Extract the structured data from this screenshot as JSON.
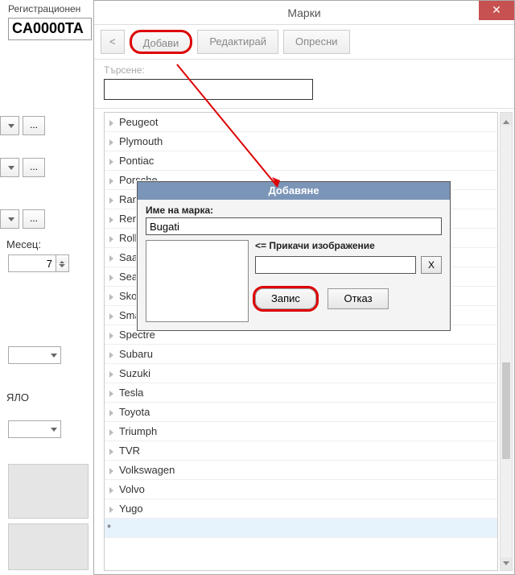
{
  "left": {
    "reg_label": "Регистрационен",
    "reg_value": "CA0000TA",
    "browse_txt": "...",
    "month_label": "Месец:",
    "month_value": "7",
    "yalo": "ЯЛО"
  },
  "window": {
    "title": "Марки",
    "close": "✕",
    "toolbar": {
      "back": "<",
      "add": "Добави",
      "edit": "Редактирай",
      "refresh": "Опресни"
    },
    "search_label": "Търсене:",
    "search_value": ""
  },
  "list": [
    "Peugeot",
    "Plymouth",
    "Pontiac",
    "Porsche",
    "Ram",
    "Renault",
    "Rolls-Royce",
    "Saab",
    "Seat",
    "Skoda",
    "Smart",
    "Spectre",
    "Subaru",
    "Suzuki",
    "Tesla",
    "Toyota",
    "Triumph",
    "TVR",
    "Volkswagen",
    "Volvo",
    "Yugo"
  ],
  "dialog": {
    "title": "Добавяне",
    "name_label": "Име на марка:",
    "name_value": "Bugati",
    "attach_label": "<= Прикачи изображение",
    "attach_value": "",
    "x": "X",
    "save": "Запис",
    "cancel": "Отказ"
  }
}
